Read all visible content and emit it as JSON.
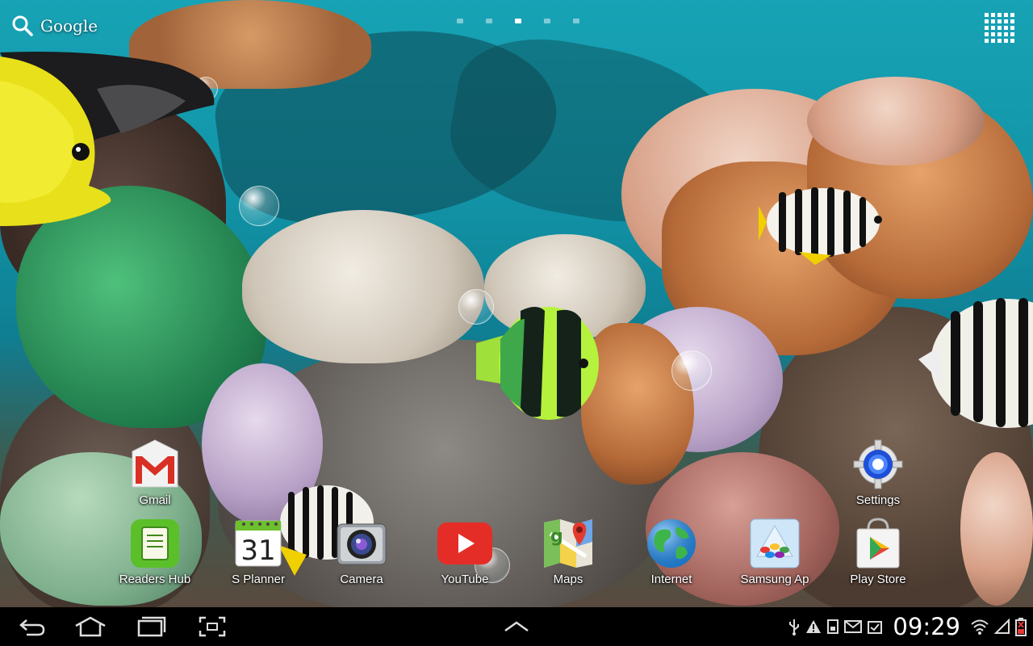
{
  "search": {
    "label": "Google"
  },
  "home_pages": {
    "count": 5,
    "active_index": 2
  },
  "apps": [
    {
      "label": "Gmail",
      "icon": "gmail-icon"
    },
    {
      "label": "Settings",
      "icon": "settings-gear-icon"
    },
    {
      "label": "Readers Hub",
      "icon": "readers-hub-icon"
    },
    {
      "label": "S Planner",
      "icon": "calendar-icon",
      "date": "31"
    },
    {
      "label": "Camera",
      "icon": "camera-icon"
    },
    {
      "label": "YouTube",
      "icon": "youtube-icon"
    },
    {
      "label": "Maps",
      "icon": "maps-icon"
    },
    {
      "label": "Internet",
      "icon": "globe-icon"
    },
    {
      "label": "Samsung Ap",
      "icon": "samsung-apps-icon"
    },
    {
      "label": "Play Store",
      "icon": "play-store-icon"
    }
  ],
  "status": {
    "time": "09:29"
  },
  "colors": {
    "nav_bg": "#000000",
    "water": "#17a3b5",
    "youtube_red": "#e52d27"
  }
}
